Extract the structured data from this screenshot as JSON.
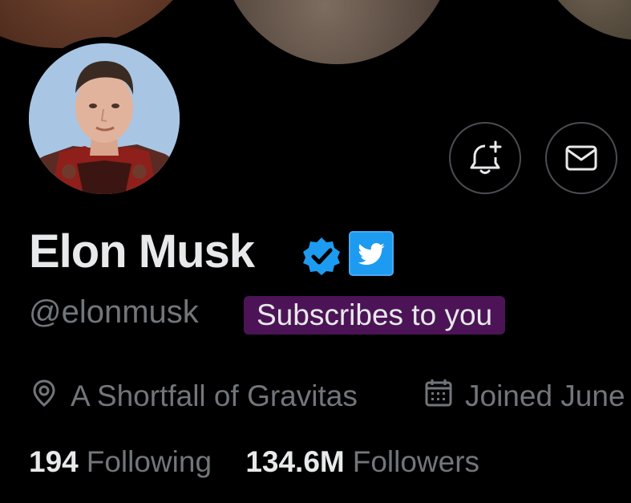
{
  "profile": {
    "display_name": "Elon Musk",
    "handle": "@elonmusk",
    "subscribe_badge": "Subscribes to you",
    "location": "A Shortfall of Gravitas",
    "joined": "Joined June",
    "following_count": "194",
    "following_label": "Following",
    "followers_count": "134.6M",
    "followers_label": "Followers"
  },
  "icons": {
    "avatar": "profile-photo",
    "notify": "bell-plus-icon",
    "message": "envelope-icon",
    "verified": "verified-check-icon",
    "affiliate": "twitter-bird-icon",
    "location": "map-pin-icon",
    "joined": "calendar-icon"
  },
  "colors": {
    "background": "#000000",
    "text_primary": "#e7e9ea",
    "text_secondary": "#71767b",
    "verified_blue": "#1d9bf0",
    "subscribe_badge_bg": "#4c1457",
    "button_border": "#4a4d52"
  }
}
